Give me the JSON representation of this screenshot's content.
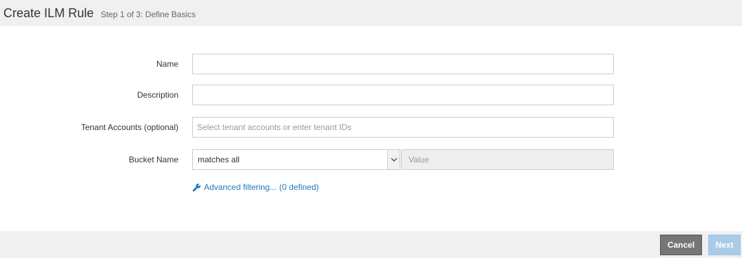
{
  "header": {
    "title": "Create ILM Rule",
    "step": "Step 1 of 3: Define Basics"
  },
  "form": {
    "name": {
      "label": "Name",
      "value": "",
      "placeholder": ""
    },
    "description": {
      "label": "Description",
      "value": "",
      "placeholder": ""
    },
    "tenant_accounts": {
      "label": "Tenant Accounts (optional)",
      "value": "",
      "placeholder": "Select tenant accounts or enter tenant IDs"
    },
    "bucket_name": {
      "label": "Bucket Name",
      "operator_selected": "matches all",
      "value_placeholder": "Value"
    },
    "advanced": {
      "link_label": "Advanced filtering...",
      "defined_label": "(0 defined)",
      "icon": "wrench-icon"
    }
  },
  "footer": {
    "cancel_label": "Cancel",
    "next_label": "Next"
  },
  "colors": {
    "link": "#1d7ab8",
    "cancel_bg": "#767676",
    "next_bg": "#a9cbe8",
    "header_bg": "#f0f0f0"
  }
}
